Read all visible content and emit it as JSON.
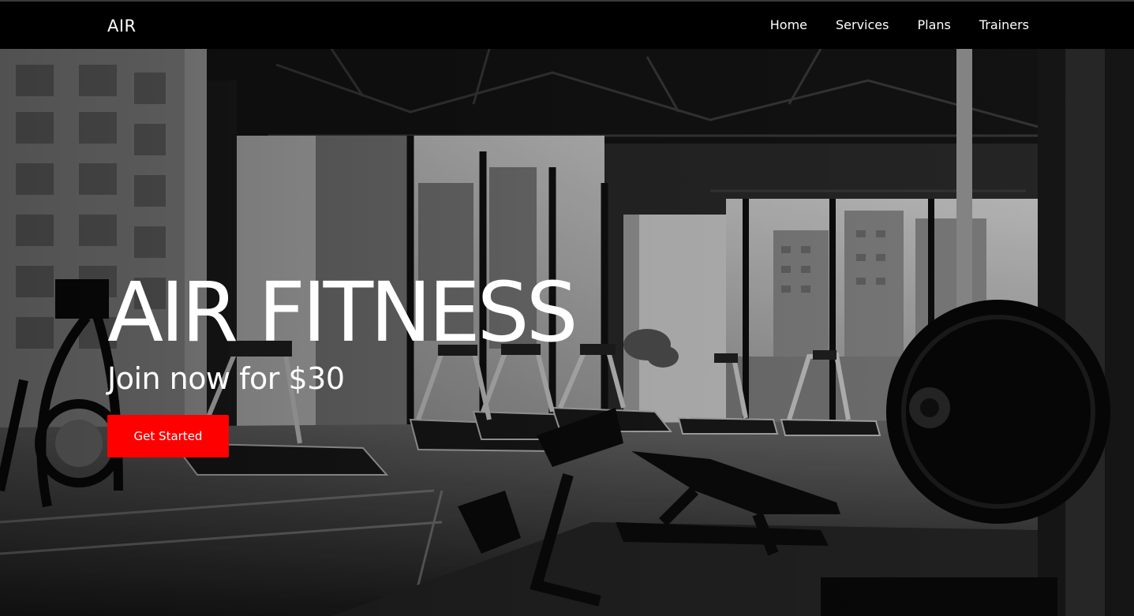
{
  "nav": {
    "logo": "AIR",
    "links": [
      "Home",
      "Services",
      "Plans",
      "Trainers"
    ]
  },
  "hero": {
    "title": "AIR FITNESS",
    "subtitle": "Join now for $30",
    "cta_label": "Get Started",
    "background": "grayscale gym photo with treadmills, ellipticals, weight bench and barbell plate",
    "cta_color": "#ff0000"
  }
}
